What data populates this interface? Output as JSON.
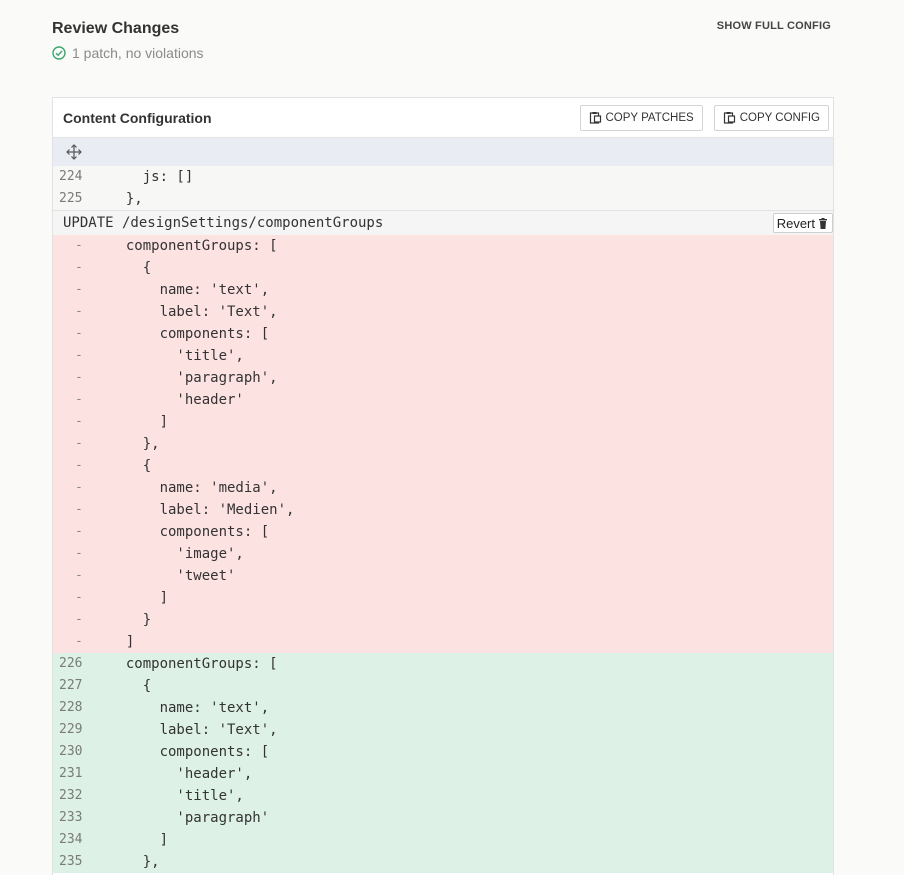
{
  "review": {
    "title": "Review Changes",
    "status": "1 patch, no violations",
    "show_full_config": "SHOW FULL CONFIG"
  },
  "panel": {
    "title": "Content Configuration",
    "copy_patches": "COPY PATCHES",
    "copy_config": "COPY CONFIG"
  },
  "context_lines": [
    {
      "num": "224",
      "text": "    js: []"
    },
    {
      "num": "225",
      "text": "  },"
    }
  ],
  "patch": {
    "header": "UPDATE /designSettings/componentGroups",
    "revert": "Revert",
    "removed": [
      "  componentGroups: [",
      "    {",
      "      name: 'text',",
      "      label: 'Text',",
      "      components: [",
      "        'title',",
      "        'paragraph',",
      "        'header'",
      "      ]",
      "    },",
      "    {",
      "      name: 'media',",
      "      label: 'Medien',",
      "      components: [",
      "        'image',",
      "        'tweet'",
      "      ]",
      "    }",
      "  ]"
    ],
    "removed_marker": "-",
    "added": [
      {
        "num": "226",
        "text": "  componentGroups: ["
      },
      {
        "num": "227",
        "text": "    {"
      },
      {
        "num": "228",
        "text": "      name: 'text',"
      },
      {
        "num": "229",
        "text": "      label: 'Text',"
      },
      {
        "num": "230",
        "text": "      components: ["
      },
      {
        "num": "231",
        "text": "        'header',"
      },
      {
        "num": "232",
        "text": "        'title',"
      },
      {
        "num": "233",
        "text": "        'paragraph'"
      },
      {
        "num": "234",
        "text": "      ]"
      },
      {
        "num": "235",
        "text": "    },"
      }
    ]
  },
  "colors": {
    "removed_bg": "#fde2e2",
    "added_bg": "#def1e6",
    "context_bg": "#f7f8f5",
    "status_ok": "#3aa76d"
  },
  "icons": {
    "status": "check-circle-icon",
    "copy": "clipboard-icon",
    "expand": "expand-arrows-icon",
    "revert": "trash-icon"
  }
}
